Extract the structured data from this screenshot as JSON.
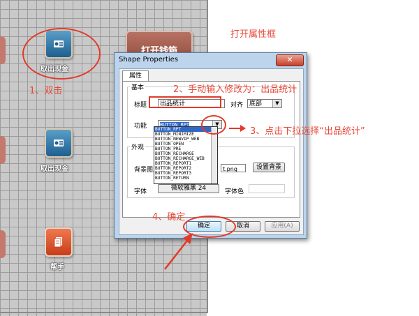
{
  "canvas": {
    "tiles": [
      {
        "label": "取出现金",
        "icon": "cash-register-icon"
      },
      {
        "label": "取出现金",
        "icon": "cash-register-icon"
      },
      {
        "label": "帮手",
        "icon": "document-icon"
      }
    ],
    "big_button_label": "打开钱箱"
  },
  "annotations": {
    "open_props": "打开属性框",
    "step1": "1、双击",
    "step2": "2、手动输入修改为：出品统计",
    "step3": "3、点击下拉选择“出品统计”",
    "step4": "4、确定",
    "accent_color": "#e84a3a"
  },
  "dialog": {
    "title": "Shape Properties",
    "close_label": "✕",
    "tab_label": "属性",
    "group_basic": "基本",
    "title_label": "标题",
    "title_value": "出品统计",
    "align_label": "对齐",
    "align_value": "底部",
    "function_label": "功能",
    "function_value": "BUTTON_RPT",
    "group_appearance": "外观",
    "bg_image_label": "背景图片",
    "bg_image_value": "t.png",
    "set_bg_button": "设置背景",
    "font_label": "字体",
    "font_value": "微软雅黑 24",
    "font_color_label": "字体色",
    "ok_button": "确定",
    "cancel_button": "取消",
    "apply_button": "应用(A)"
  },
  "dropdown_items": [
    "BUTTON_RPT",
    "BUTTON_MINIMIZE",
    "BUTTON_NEWVIP_WEB",
    "BUTTON_OPEN",
    "BUTTON_PRE",
    "BUTTON_RECHARGE",
    "BUTTON_RECHARGE_WEB",
    "BUTTON_REPORT1",
    "BUTTON_REPORT2",
    "BUTTON_REPORT3",
    "BUTTON_RETURN"
  ]
}
